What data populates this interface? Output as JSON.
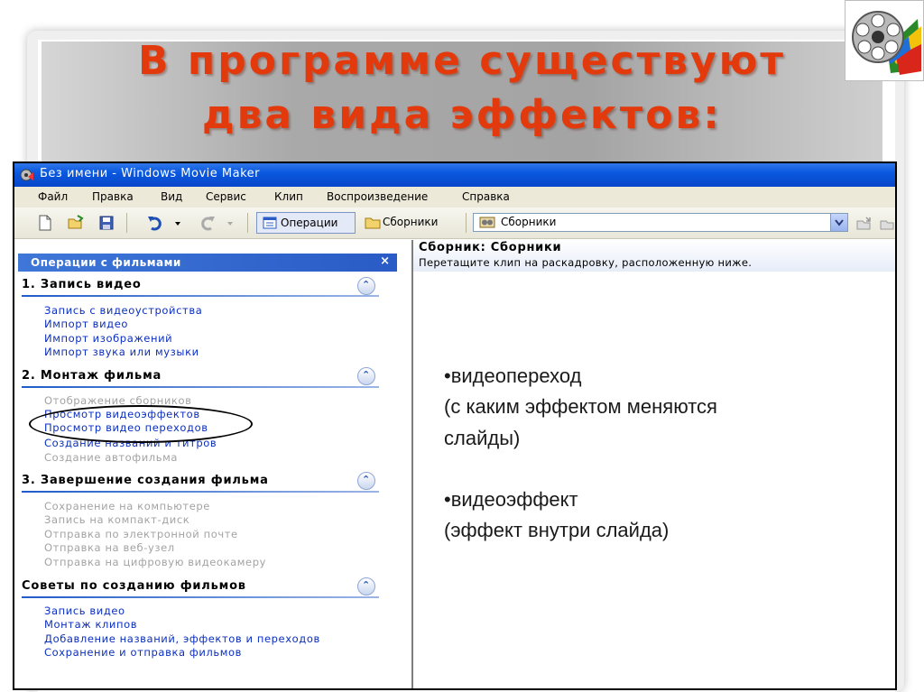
{
  "slide": {
    "title_line1": "В программе существуют",
    "title_line2": "два вида эффектов:"
  },
  "logo": {
    "icon": "movie-maker-film-reel-icon"
  },
  "window": {
    "title": "Без имени - Windows Movie Maker",
    "menu": [
      "Файл",
      "Правка",
      "Вид",
      "Сервис",
      "Клип",
      "Воспроизведение",
      "Справка"
    ],
    "toolbar": {
      "operations_label": "Операции",
      "collections_label": "Сборники",
      "combo_value": "Сборники"
    }
  },
  "taskpane": {
    "header": "Операции с фильмами",
    "close": "×",
    "sections": [
      {
        "title": "1. Запись видео",
        "items": [
          {
            "label": "Запись с видеоустройства",
            "enabled": true
          },
          {
            "label": "Импорт видео",
            "enabled": true
          },
          {
            "label": "Импорт изображений",
            "enabled": true
          },
          {
            "label": "Импорт звука или музыки",
            "enabled": true
          }
        ]
      },
      {
        "title": "2. Монтаж фильма",
        "items": [
          {
            "label": "Отображение сборников",
            "enabled": false
          },
          {
            "label": "Просмотр видеоэффектов",
            "enabled": true
          },
          {
            "label": "Просмотр видео переходов",
            "enabled": true
          },
          {
            "label": "Создание названий и титров",
            "enabled": true
          },
          {
            "label": "Создание автофильма",
            "enabled": false
          }
        ]
      },
      {
        "title": "3. Завершение создания фильма",
        "items": [
          {
            "label": "Сохранение на компьютере",
            "enabled": false
          },
          {
            "label": "Запись на компакт-диск",
            "enabled": false
          },
          {
            "label": "Отправка по электронной почте",
            "enabled": false
          },
          {
            "label": "Отправка на веб-узел",
            "enabled": false
          },
          {
            "label": "Отправка на цифровую видеокамеру",
            "enabled": false
          }
        ]
      },
      {
        "title": "Советы по созданию фильмов",
        "items": [
          {
            "label": "Запись видео",
            "enabled": true
          },
          {
            "label": "Монтаж клипов",
            "enabled": true
          },
          {
            "label": "Добавление названий, эффектов и переходов",
            "enabled": true
          },
          {
            "label": "Сохранение и отправка фильмов",
            "enabled": true
          }
        ]
      }
    ]
  },
  "collection": {
    "title": "Сборник: Сборники",
    "hint": "Перетащите клип на раскадровку, расположенную ниже."
  },
  "effects_text": {
    "line1": "•видеопереход",
    "line2": "(с каким эффектом меняются",
    "line3": "слайды)",
    "line4": "•видеоэффект",
    "line5": "(эффект внутри слайда)"
  },
  "colors": {
    "title": "#e23a0c",
    "link": "#0b2fbf",
    "disabled": "#a3a3a3",
    "xp_blue": "#0a58df"
  }
}
